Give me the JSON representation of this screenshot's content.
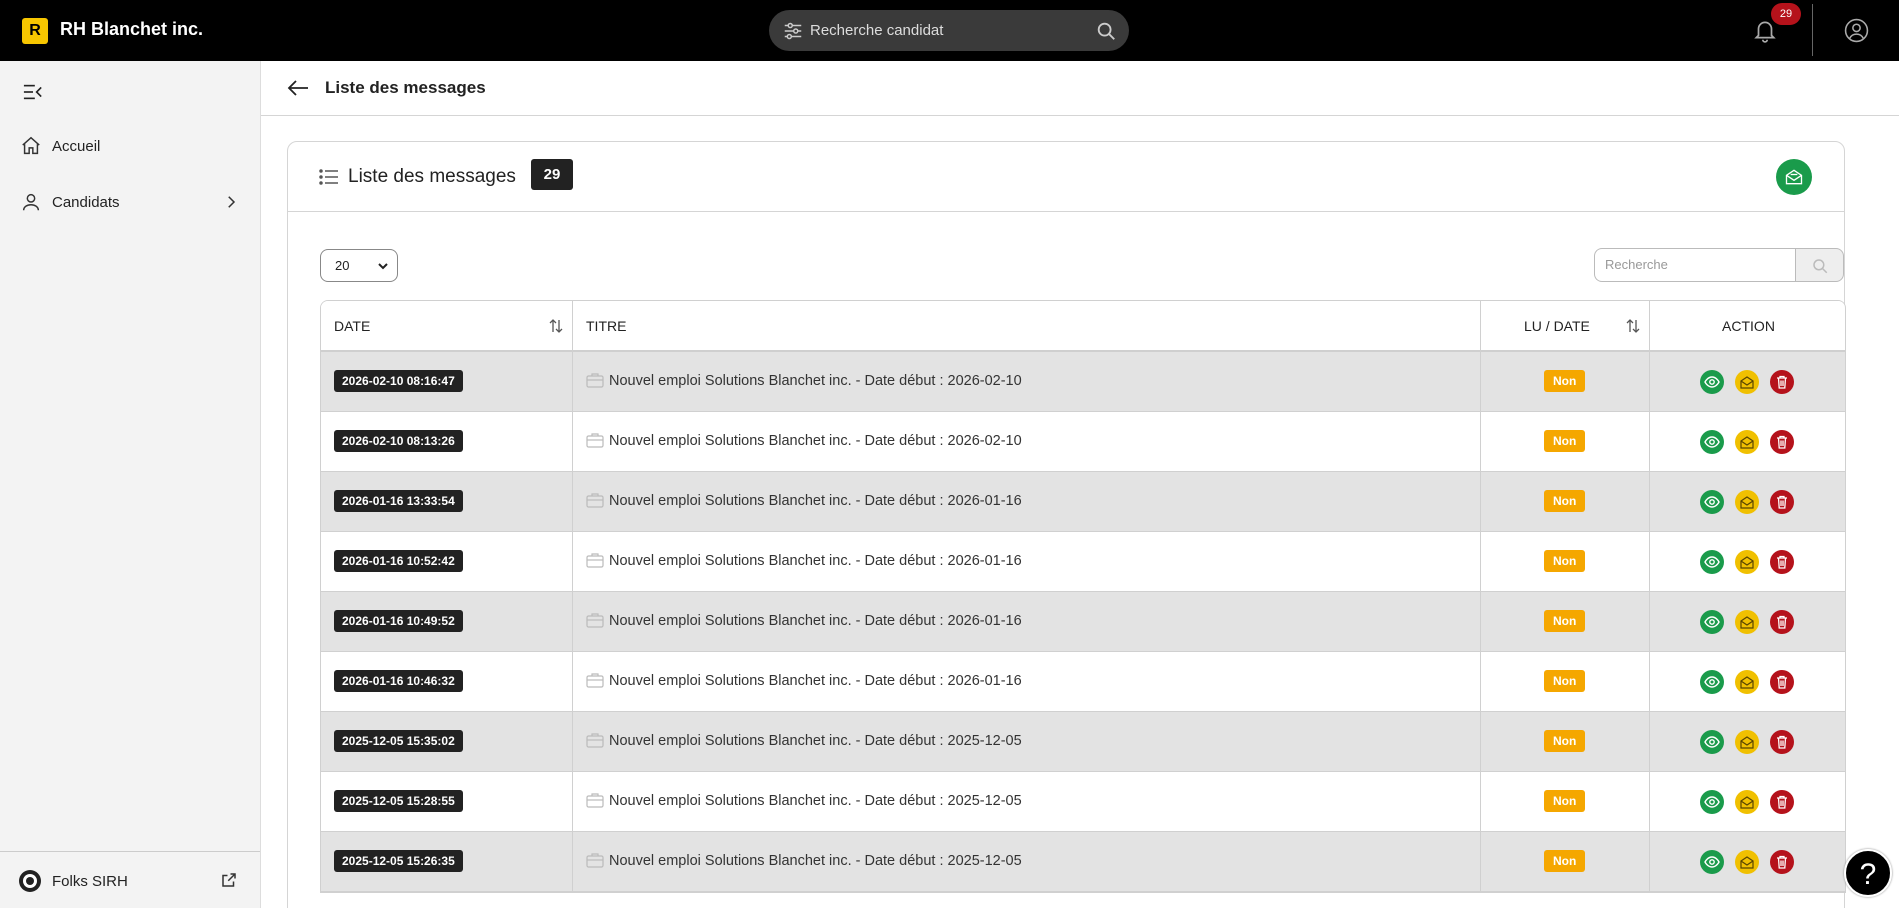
{
  "header": {
    "logo_letter": "R",
    "app_title": "RH Blanchet inc.",
    "search_placeholder": "Recherche candidat",
    "notification_count": "29"
  },
  "sidebar": {
    "items": [
      {
        "label": "Accueil",
        "icon": "home-icon"
      },
      {
        "label": "Candidats",
        "icon": "user-icon"
      }
    ],
    "footer_label": "Folks SIRH"
  },
  "page": {
    "title": "Liste des messages"
  },
  "card": {
    "title": "Liste des messages",
    "count": "29",
    "page_size": "20",
    "search_placeholder": "Recherche"
  },
  "table": {
    "columns": [
      "DATE",
      "TITRE",
      "LU / DATE",
      "ACTION"
    ],
    "rows": [
      {
        "date": "2026-02-10 08:16:47",
        "title": "Nouvel emploi Solutions Blanchet inc. - Date début : 2026-02-10",
        "lu": "Non"
      },
      {
        "date": "2026-02-10 08:13:26",
        "title": "Nouvel emploi Solutions Blanchet inc. - Date début : 2026-02-10",
        "lu": "Non"
      },
      {
        "date": "2026-01-16 13:33:54",
        "title": "Nouvel emploi Solutions Blanchet inc. - Date début : 2026-01-16",
        "lu": "Non"
      },
      {
        "date": "2026-01-16 10:52:42",
        "title": "Nouvel emploi Solutions Blanchet inc. - Date début : 2026-01-16",
        "lu": "Non"
      },
      {
        "date": "2026-01-16 10:49:52",
        "title": "Nouvel emploi Solutions Blanchet inc. - Date début : 2026-01-16",
        "lu": "Non"
      },
      {
        "date": "2026-01-16 10:46:32",
        "title": "Nouvel emploi Solutions Blanchet inc. - Date début : 2026-01-16",
        "lu": "Non"
      },
      {
        "date": "2025-12-05 15:35:02",
        "title": "Nouvel emploi Solutions Blanchet inc. - Date début : 2025-12-05",
        "lu": "Non"
      },
      {
        "date": "2025-12-05 15:28:55",
        "title": "Nouvel emploi Solutions Blanchet inc. - Date début : 2025-12-05",
        "lu": "Non"
      },
      {
        "date": "2025-12-05 15:26:35",
        "title": "Nouvel emploi Solutions Blanchet inc. - Date début : 2025-12-05",
        "lu": "Non"
      }
    ]
  },
  "help_label": "?",
  "colors": {
    "topbar": "#000000",
    "brand_yellow": "#f7c600",
    "view_green": "#1a9b4b",
    "mail_yellow": "#f0c000",
    "delete_red": "#b5121b",
    "non_orange": "#f5a700"
  }
}
